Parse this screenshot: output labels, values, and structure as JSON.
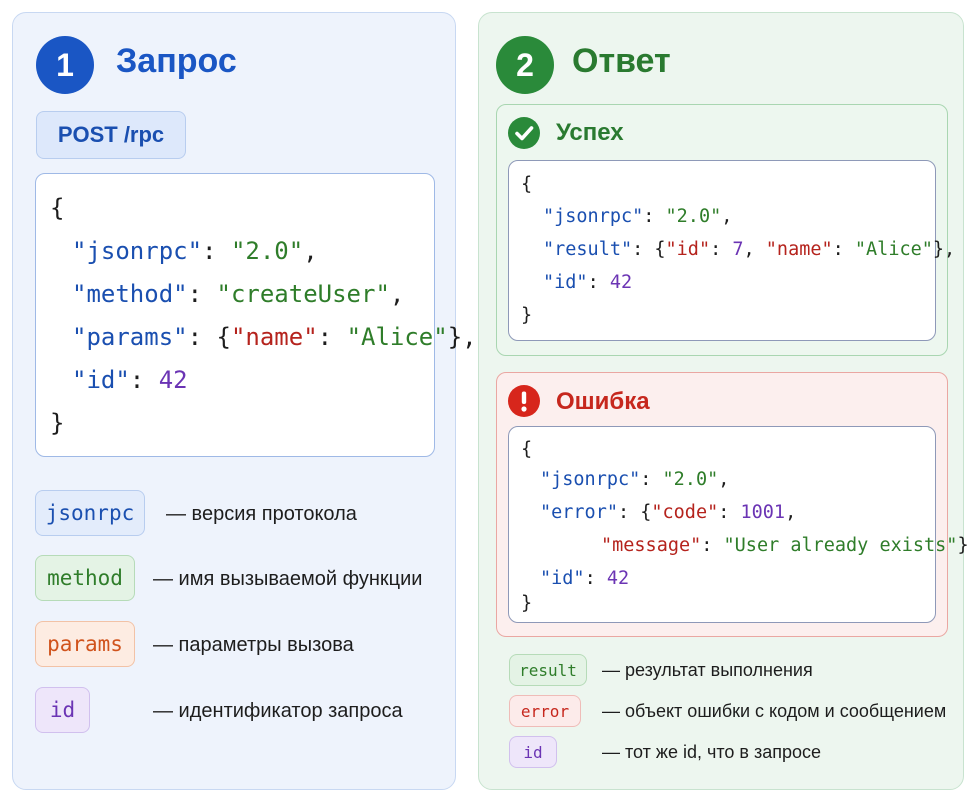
{
  "request": {
    "number": "1",
    "title": "Запрос",
    "endpoint": "POST /rpc",
    "code": {
      "open_brace": "{",
      "jsonrpc_key": "\"jsonrpc\"",
      "jsonrpc_val": "\"2.0\"",
      "method_key": "\"method\"",
      "method_val": "\"createUser\"",
      "params_key": "\"params\"",
      "params_name_key": "\"name\"",
      "params_name_val": "\"Alice\"",
      "id_key": "\"id\"",
      "id_val": "42",
      "close_brace": "}"
    },
    "legend": [
      {
        "term": "jsonrpc",
        "desc": "— версия протокола"
      },
      {
        "term": "method",
        "desc": "— имя вызываемой функции"
      },
      {
        "term": "params",
        "desc": "— параметры вызова"
      },
      {
        "term": "id",
        "desc": "— идентификатор запроса"
      }
    ]
  },
  "response": {
    "number": "2",
    "title": "Ответ",
    "success": {
      "title": "Успех",
      "code": {
        "open_brace": "{",
        "jsonrpc_key": "\"jsonrpc\"",
        "jsonrpc_val": "\"2.0\"",
        "result_key": "\"result\"",
        "result_id_key": "\"id\"",
        "result_id_val": "7",
        "result_name_key": "\"name\"",
        "result_name_val": "\"Alice\"",
        "id_key": "\"id\"",
        "id_val": "42",
        "close_brace": "}"
      }
    },
    "error": {
      "title": "Ошибка",
      "code": {
        "open_brace": "{",
        "jsonrpc_key": "\"jsonrpc\"",
        "jsonrpc_val": "\"2.0\"",
        "error_key": "\"error\"",
        "code_key": "\"code\"",
        "code_val": "1001",
        "message_key": "\"message\"",
        "message_val": "\"User already exists\"",
        "id_key": "\"id\"",
        "id_val": "42",
        "close_brace": "}"
      }
    },
    "legend": [
      {
        "term": "result",
        "desc": "— результат выполнения"
      },
      {
        "term": "error",
        "desc": "— объект ошибки с кодом и сообщением"
      },
      {
        "term": "id",
        "desc": "— тот же id, что в запросе"
      }
    ]
  },
  "colors": {
    "blue": "#1a4fb0",
    "green": "#2f7d2a",
    "red": "#b5231d",
    "purple": "#6b34b4"
  },
  "icons": {
    "success": "check-circle-icon",
    "error": "exclamation-circle-icon"
  }
}
